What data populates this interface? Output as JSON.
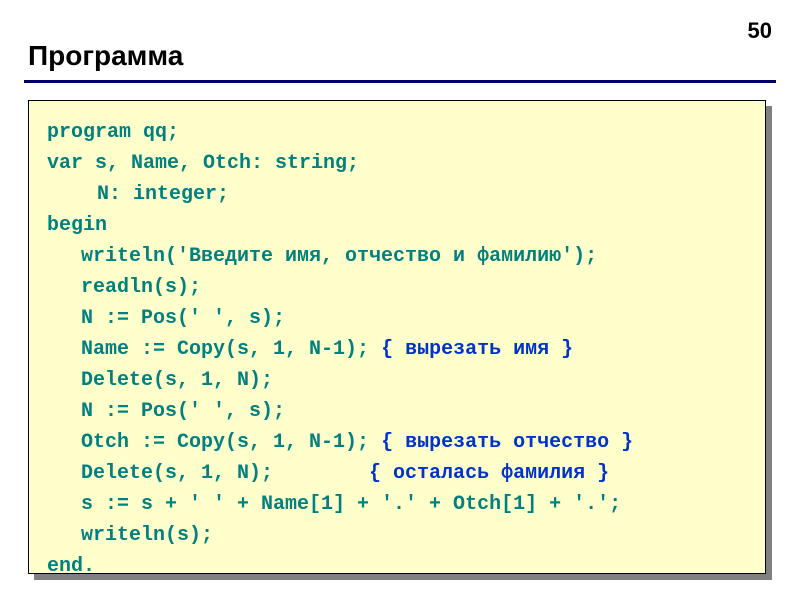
{
  "page_number": "50",
  "title": "Программа",
  "code": {
    "lines": [
      {
        "text": "program qq;",
        "indent": "indent1"
      },
      {
        "text": "var s, Name, Otch: string;",
        "indent": "indent1"
      },
      {
        "text": "N: integer;",
        "indent": "indent2"
      },
      {
        "text": "begin",
        "indent": "indent1"
      },
      {
        "text": "writeln('Введите имя, отчество и фамилию');",
        "indent": "indent3"
      },
      {
        "text": "readln(s);",
        "indent": "indent3"
      },
      {
        "text": "N := Pos(' ', s);",
        "indent": "indent3"
      },
      {
        "text": "Name := Copy(s, 1, N-1); ",
        "comment": "{ вырезать имя }",
        "indent": "indent3"
      },
      {
        "text": "Delete(s, 1, N);",
        "indent": "indent3"
      },
      {
        "text": "N := Pos(' ', s);",
        "indent": "indent3"
      },
      {
        "text": "Otch := Copy(s, 1, N-1); ",
        "comment": "{ вырезать отчество }",
        "indent": "indent3"
      },
      {
        "text": "Delete(s, 1, N);        ",
        "comment": "{ осталась фамилия }",
        "indent": "indent3"
      },
      {
        "text": "s := s + ' ' + Name[1] + '.' + Otch[1] + '.';",
        "indent": "indent3"
      },
      {
        "text": "writeln(s);",
        "indent": "indent3"
      },
      {
        "text": "end.",
        "indent": "indent1"
      }
    ]
  }
}
